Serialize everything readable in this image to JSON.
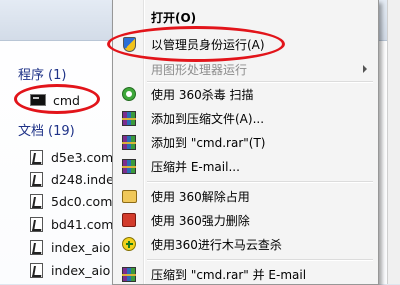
{
  "results": {
    "programs_header": "程序",
    "programs_count": "(1)",
    "program_item": "cmd",
    "docs_header": "文档",
    "docs_count": "(19)",
    "docs": [
      "d5e3.com",
      "d248.inde",
      "5dc0.com",
      "bd41.com",
      "index_aio",
      "index_aio"
    ]
  },
  "context_menu": {
    "items": [
      {
        "label": "打开(O)",
        "icon": "none",
        "bold": true
      },
      {
        "label": "以管理员身份运行(A)",
        "icon": "uac-shield-icon"
      },
      {
        "label": "用图形处理器运行",
        "icon": "none",
        "disabled": true,
        "submenu": true
      },
      {
        "label": "使用 360杀毒 扫描",
        "icon": "360-antivirus-icon"
      },
      {
        "label": "添加到压缩文件(A)...",
        "icon": "winrar-icon"
      },
      {
        "label": "添加到 \"cmd.rar\"(T)",
        "icon": "winrar-icon"
      },
      {
        "label": "压缩并 E-mail...",
        "icon": "winrar-icon"
      },
      {
        "label": "使用 360解除占用",
        "icon": "unlock-icon"
      },
      {
        "label": "使用 360强力删除",
        "icon": "shred-icon"
      },
      {
        "label": "使用360进行木马云查杀",
        "icon": "trojan-scan-icon"
      },
      {
        "label": "压缩到 \"cmd.rar\" 并 E-mail",
        "icon": "winrar-icon"
      }
    ]
  },
  "colors": {
    "highlight_oval": "#e2141a",
    "group_header": "#1e3287"
  }
}
